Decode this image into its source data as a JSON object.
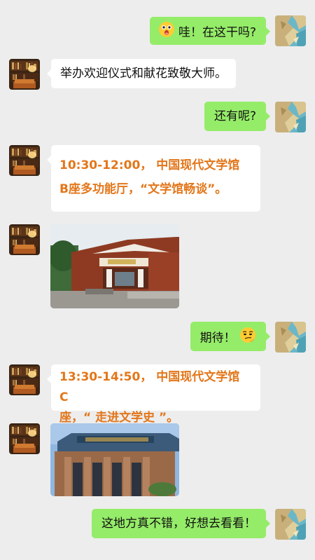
{
  "messages": [
    {
      "side": "right",
      "text": "哇！在这干吗?",
      "emoji": "surprised-face"
    },
    {
      "side": "left",
      "text": "举办欢迎仪式和献花致敬大师。"
    },
    {
      "side": "right",
      "text": "还有呢?"
    },
    {
      "side": "left",
      "line1": "10:30-12:00，  中国现代文学馆",
      "line2": "B座多功能厅，“文学馆畅谈”。"
    },
    {
      "side": "left",
      "image": "literature-museum-building-a"
    },
    {
      "side": "right",
      "text": "期待！",
      "emoji": "smirking-face"
    },
    {
      "side": "left",
      "line1": "13:30-14:50，  中国现代文学馆 C",
      "line2": "座，“ 走进文学史 ”。"
    },
    {
      "side": "left",
      "image": "literature-museum-building-c"
    },
    {
      "side": "right",
      "text": "这地方真不错，好想去看看！"
    }
  ],
  "colors": {
    "background": "#ededed",
    "sent_bubble": "#95ec69",
    "received_bubble": "#ffffff",
    "highlight": "#e3761a"
  }
}
